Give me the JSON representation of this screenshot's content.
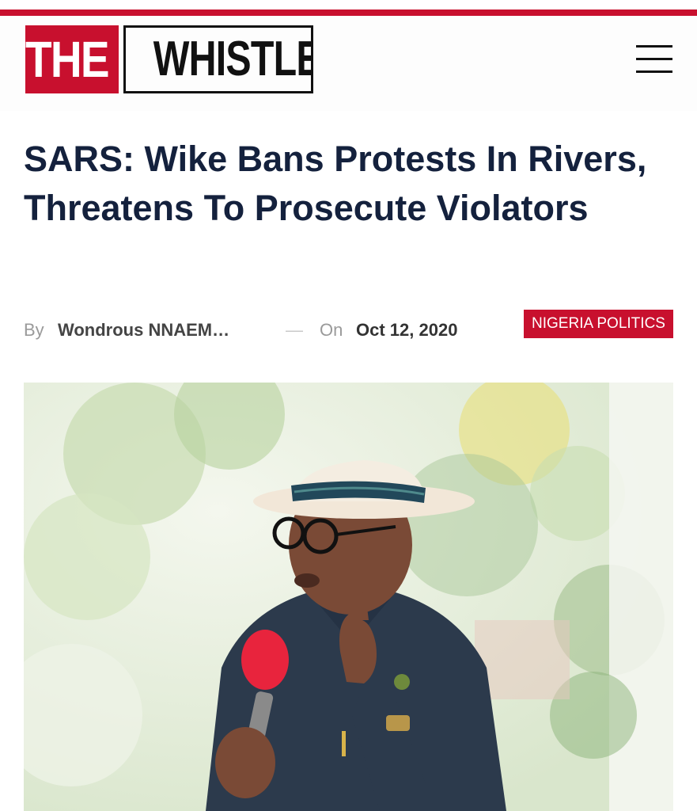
{
  "header": {
    "logo_the": "THE",
    "logo_name": "WHISTLER",
    "menu_icon": "hamburger-menu-icon",
    "brand_color": "#c8102e"
  },
  "article": {
    "title": "SARS: Wike Bans Protests In Rivers, Threatens To Prosecute Violators",
    "by_label": "By",
    "author": "Wondrous NNAEM…",
    "separator": "—",
    "on_label": "On",
    "date": "Oct 12, 2020",
    "category": "NIGERIA POLITICS"
  },
  "colors": {
    "title": "#14213d",
    "accent": "#c8102e"
  }
}
